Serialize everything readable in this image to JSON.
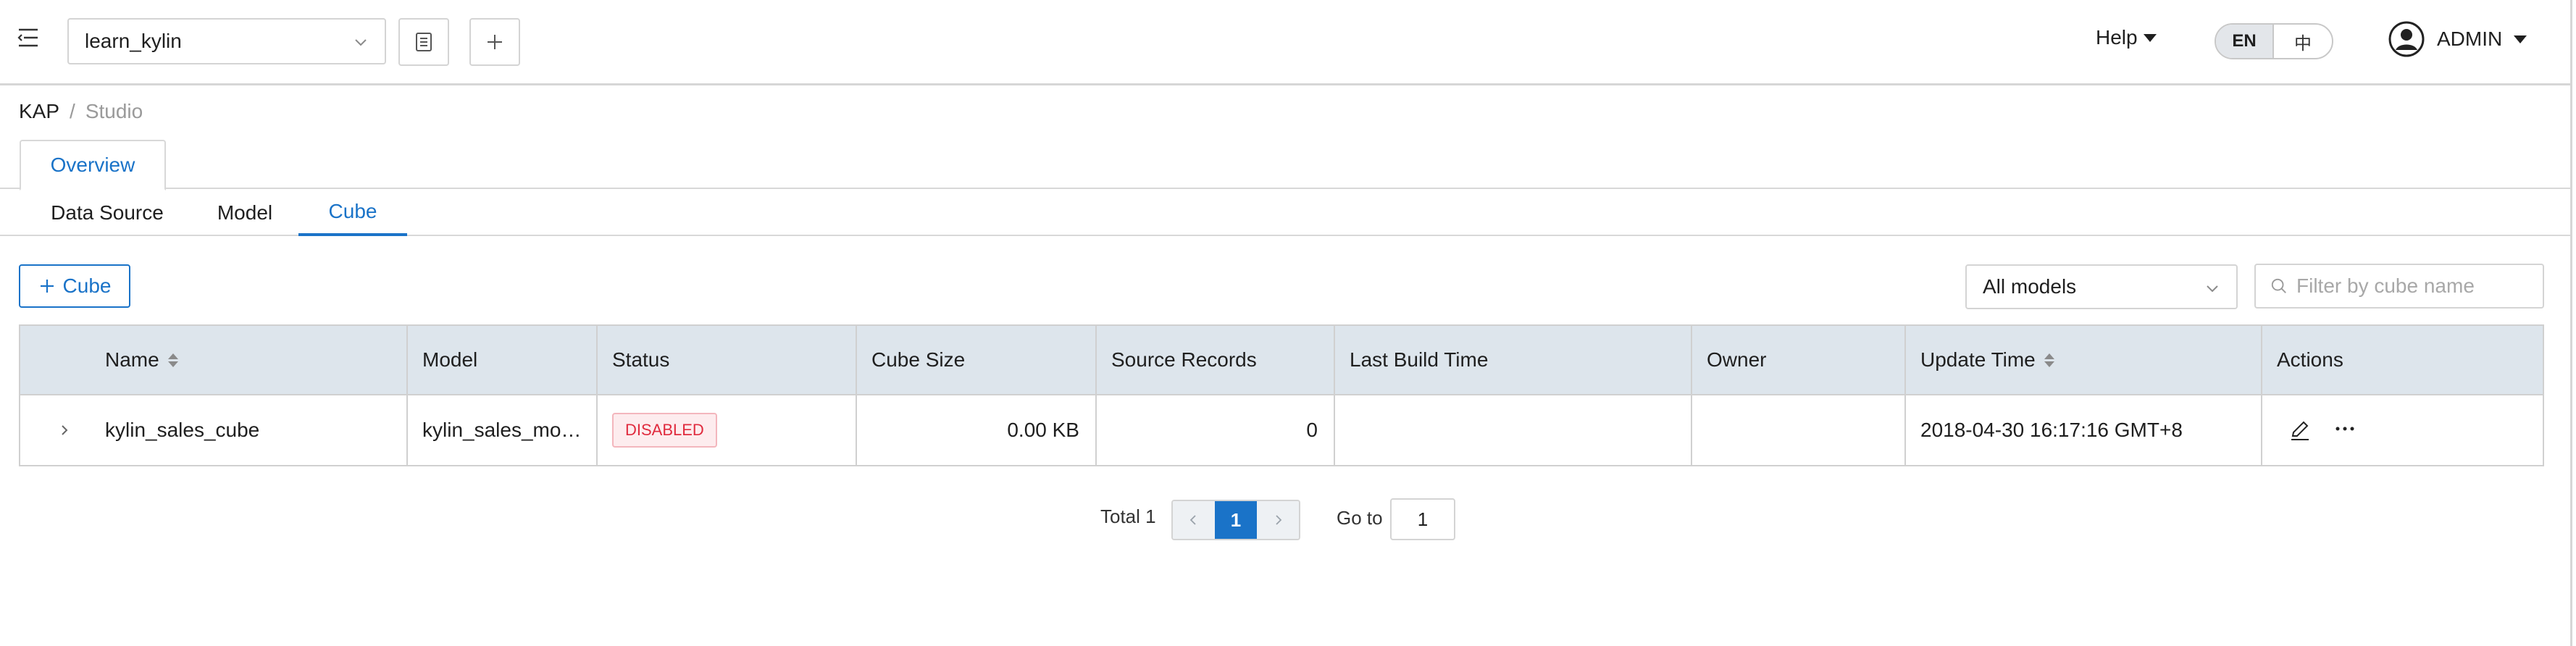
{
  "header": {
    "project_select": "learn_kylin",
    "help_label": "Help",
    "lang_options": [
      "EN",
      "中"
    ],
    "lang_active": "EN",
    "user_label": "ADMIN"
  },
  "breadcrumb": {
    "root": "KAP",
    "separator": "/",
    "current": "Studio"
  },
  "tabs": {
    "overview": "Overview",
    "sub": [
      "Data Source",
      "Model",
      "Cube"
    ],
    "active_sub": "Cube"
  },
  "toolbar": {
    "add_cube_label": "Cube",
    "models_select": "All models",
    "filter_placeholder": "Filter by cube name",
    "filter_value": ""
  },
  "table": {
    "headers": [
      "Name",
      "Model",
      "Status",
      "Cube Size",
      "Source Records",
      "Last Build Time",
      "Owner",
      "Update Time",
      "Actions"
    ],
    "rows": [
      {
        "name": "kylin_sales_cube",
        "model": "kylin_sales_mo…",
        "status": "DISABLED",
        "cube_size": "0.00 KB",
        "source_records": "0",
        "last_build_time": "",
        "owner": "",
        "update_time": "2018-04-30 16:17:16 GMT+8"
      }
    ]
  },
  "pagination": {
    "total_label": "Total 1",
    "current_page": "1",
    "goto_label": "Go to",
    "goto_value": "1"
  },
  "colors": {
    "accent": "#1a73c8",
    "header_row_bg": "#dde5ec",
    "danger": "#e02b3e"
  }
}
